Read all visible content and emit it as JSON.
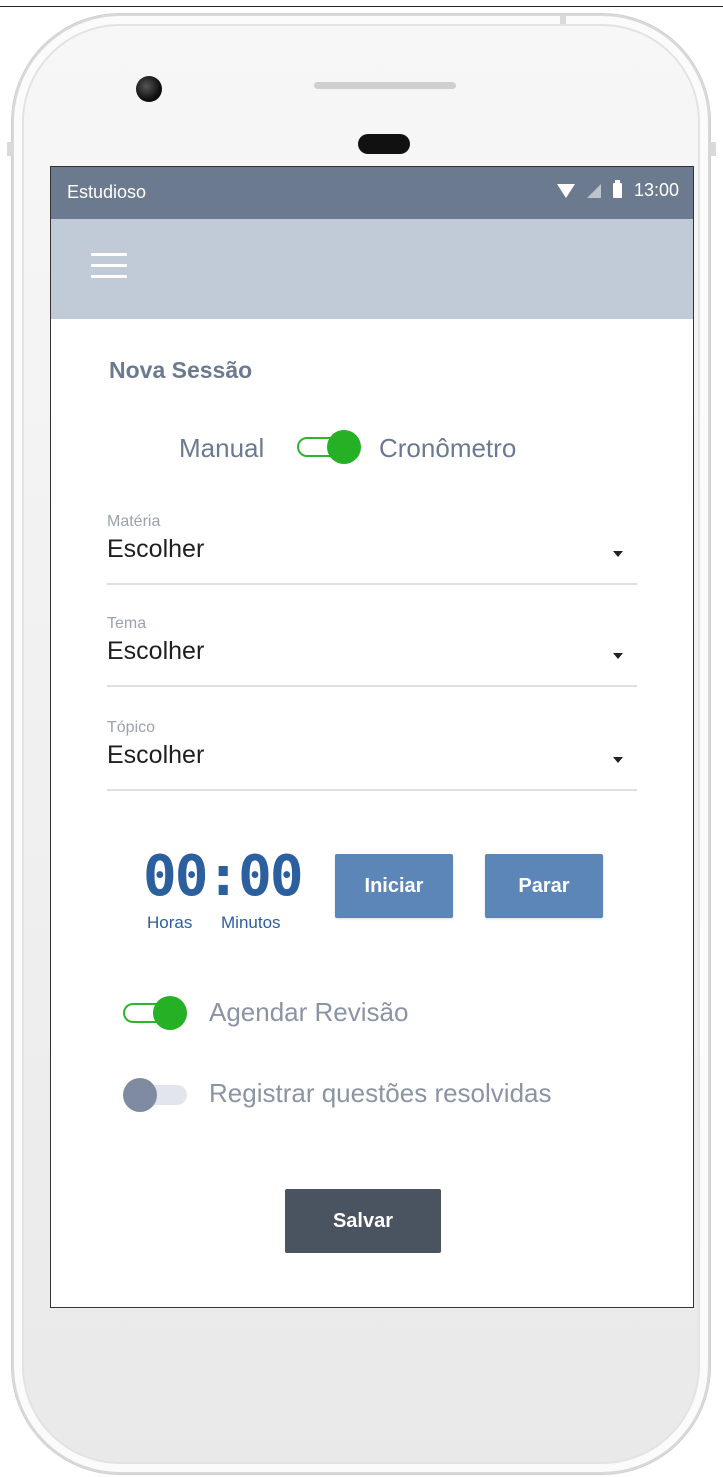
{
  "status_bar": {
    "app_name": "Estudioso",
    "time": "13:00",
    "icons": [
      "wifi-icon",
      "signal-icon",
      "battery-icon"
    ]
  },
  "app_bar": {
    "menu_icon": "menu-icon"
  },
  "page": {
    "title": "Nova Sessão",
    "mode_toggle": {
      "left_label": "Manual",
      "right_label": "Cronômetro",
      "on": true
    }
  },
  "fields": [
    {
      "label": "Matéria",
      "value": "Escolher"
    },
    {
      "label": "Tema",
      "value": "Escolher"
    },
    {
      "label": "Tópico",
      "value": "Escolher"
    }
  ],
  "timer": {
    "display": "00:00",
    "hours_label": "Horas",
    "minutes_label": "Minutos",
    "start_label": "Iniciar",
    "stop_label": "Parar"
  },
  "options": [
    {
      "label": "Agendar Revisão",
      "on": true
    },
    {
      "label": "Registrar questões resolvidas",
      "on": false
    }
  ],
  "save_label": "Salvar",
  "colors": {
    "status_bar": "#6c7a8f",
    "app_bar": "#c0cbd7",
    "toggle_on": "#25b025",
    "toggle_off": "#7f8ba0",
    "timer": "#2c5f9e",
    "action_button": "#5d86b8",
    "save_button": "#4a5360"
  }
}
